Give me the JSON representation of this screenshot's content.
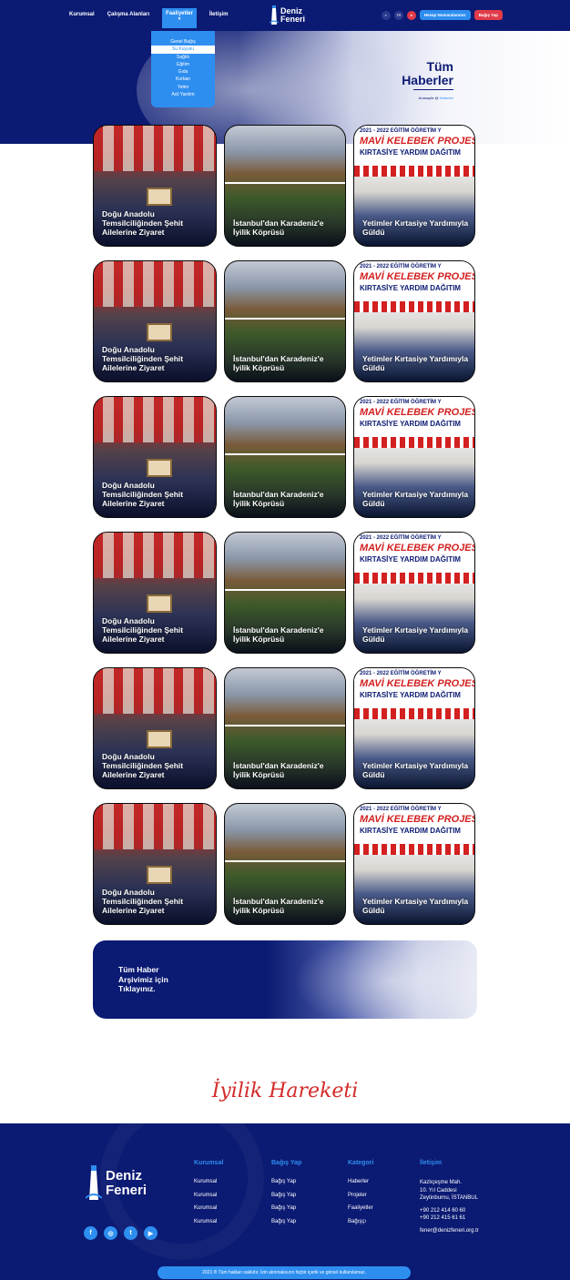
{
  "header": {
    "nav": [
      "Kurumsal",
      "Çalışma Alanları",
      "Faaliyetler",
      "İletişim"
    ],
    "active_nav_index": 2,
    "caret": "▾",
    "logo_line1": "Deniz",
    "logo_line2": "Feneri",
    "search_icon": "⌕",
    "lang": "TR",
    "user_icon": "●",
    "account_btn": "Hesap Numaralarımız",
    "donate_btn": "Bağış Yap"
  },
  "dropdown": {
    "items": [
      "Genel Bağış",
      "Su Kuyusu",
      "Sağlık",
      "Eğitim",
      "Gıda",
      "Kurban",
      "Yetim",
      "Acil Yardım"
    ],
    "selected_index": 1
  },
  "hero": {
    "title_line1": "Tüm",
    "title_line2": "Haberler",
    "breadcrumb_home": "Anasayfa",
    "breadcrumb_sep": " @ ",
    "breadcrumb_current": "Haberler"
  },
  "news": {
    "rows": [
      [
        "Doğu Anadolu Temsilciliğinden Şehit Ailelerine Ziyaret",
        "İstanbul'dan Karadeniz'e İyilik Köprüsü",
        "Yetimler Kırtasiye Yardımıyla Güldü"
      ],
      [
        "Doğu Anadolu Temsilciliğinden Şehit Ailelerine Ziyaret",
        "İstanbul'dan Karadeniz'e İyilik Köprüsü",
        "Yetimler Kırtasiye Yardımıyla Güldü"
      ],
      [
        "Doğu Anadolu Temsilciliğinden Şehit Ailelerine Ziyaret",
        "İstanbul'dan Karadeniz'e İyilik Köprüsü",
        "Yetimler Kırtasiye Yardımıyla Güldü"
      ],
      [
        "Doğu Anadolu Temsilciliğinden Şehit Ailelerine Ziyaret",
        "İstanbul'dan Karadeniz'e İyilik Köprüsü",
        "Yetimler Kırtasiye Yardımıyla Güldü"
      ],
      [
        "Doğu Anadolu Temsilciliğinden Şehit Ailelerine Ziyaret",
        "İstanbul'dan Karadeniz'e İyilik Köprüsü",
        "Yetimler Kırtasiye Yardımıyla Güldü"
      ],
      [
        "Doğu Anadolu Temsilciliğinden Şehit Ailelerine Ziyaret",
        "İstanbul'dan Karadeniz'e İyilik Köprüsü",
        "Yetimler Kırtasiye Yardımıyla Güldü"
      ]
    ],
    "banner_line1": "2021 - 2022 EĞİTİM ÖĞRETİM Y",
    "banner_line2": "MAVİ KELEBEK PROJESİ",
    "banner_line3": "KIRTASİYE YARDIM DAĞITIM"
  },
  "archive": {
    "line1": "Tüm Haber",
    "line2": "Arşivimiz için",
    "line3": "Tıklayınız."
  },
  "signature": "İyilik Hareketi",
  "footer": {
    "logo_line1": "Deniz",
    "logo_line2": "Feneri",
    "col1": {
      "title": "Kurumsal",
      "items": [
        "Kurumsal",
        "Kurumsal",
        "Kurumsal",
        "Kurumsal"
      ]
    },
    "col2": {
      "title": "Bağış Yap",
      "items": [
        "Bağış Yap",
        "Bağış Yap",
        "Bağış Yap",
        "Bağış Yap"
      ]
    },
    "col3": {
      "title": "Kategori",
      "items": [
        "Haberler",
        "Projeler",
        "Faaliyetler",
        "Bağışçı"
      ]
    },
    "col4": {
      "title": "İletişim",
      "address": [
        "Kazlıçeşme Mah.",
        "10. Yıl Caddesi",
        "Zeytinburnu, İSTANBUL"
      ],
      "phones": [
        "+90 212 414 60 60",
        "+90 212 415 61 61"
      ],
      "email": "fener@denizfeneri.org.tr"
    },
    "social": [
      {
        "icon": "facebook-icon",
        "glyph": "f"
      },
      {
        "icon": "instagram-icon",
        "glyph": "◎"
      },
      {
        "icon": "twitter-icon",
        "glyph": "t"
      },
      {
        "icon": "youtube-icon",
        "glyph": "▶"
      }
    ],
    "copyright": "2021 ® Tüm hakları saklıdır. İzin alınmaksızın hiçbir içerik ve görsel kullanılamaz."
  },
  "colors": {
    "navy": "#0b1a72",
    "blue": "#2e8ef0",
    "red": "#e23b4a"
  }
}
